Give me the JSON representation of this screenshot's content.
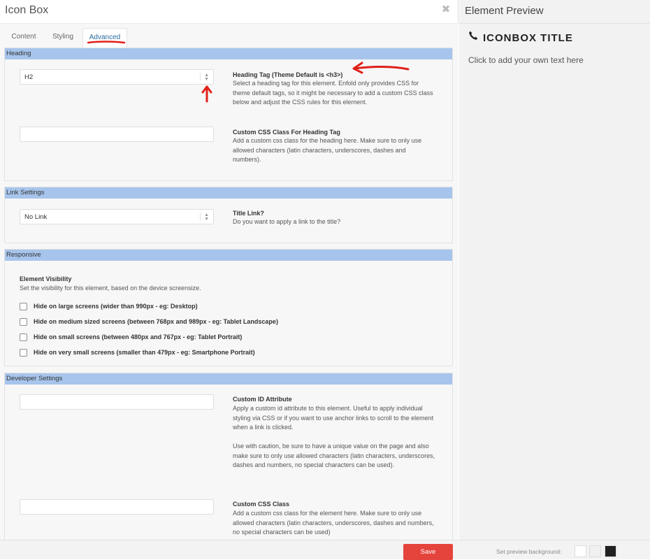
{
  "modal": {
    "title": "Icon Box",
    "tabs": [
      "Content",
      "Styling",
      "Advanced"
    ],
    "active_tab": "Advanced"
  },
  "sections": {
    "heading": {
      "header": "Heading",
      "tag_select": {
        "value": "H2"
      },
      "tag_title": "Heading Tag (Theme Default is <h3>)",
      "tag_desc": "Select a heading tag for this element. Enfold only provides CSS for theme default tags, so it might be necessary to add a custom CSS class below and adjust the CSS rules for this element.",
      "css_value": "",
      "css_title": "Custom CSS Class For Heading Tag",
      "css_desc": "Add a custom css class for the heading here. Make sure to only use allowed characters (latin characters, underscores, dashes and numbers)."
    },
    "link": {
      "header": "Link Settings",
      "select": {
        "value": "No Link"
      },
      "title": "Title Link?",
      "desc": "Do you want to apply a link to the title?"
    },
    "responsive": {
      "header": "Responsive",
      "title": "Element Visibility",
      "desc": "Set the visibility for this element, based on the device screensize.",
      "checkboxes": [
        {
          "label": "Hide on large screens (wider than 990px - eg: Desktop)",
          "checked": false
        },
        {
          "label": "Hide on medium sized screens (between 768px and 989px - eg: Tablet Landscape)",
          "checked": false
        },
        {
          "label": "Hide on small screens (between 480px and 767px - eg: Tablet Portrait)",
          "checked": false
        },
        {
          "label": "Hide on very small screens (smaller than 479px - eg: Smartphone Portrait)",
          "checked": false
        }
      ]
    },
    "developer": {
      "header": "Developer Settings",
      "id_value": "",
      "id_title": "Custom ID Attribute",
      "id_desc1": "Apply a custom id attribute to this element. Useful to apply individual styling via CSS or if you want to use anchor links to scroll to the element when a link is clicked.",
      "id_desc2": "Use with caution, be sure to have a unique value on the page and also make sure to only use allowed characters (latin characters, underscores, dashes and numbers, no special characters can be used).",
      "class_value": "",
      "class_title": "Custom CSS Class",
      "class_desc": "Add a custom css class for the element here. Make sure to only use allowed characters (latin characters, underscores, dashes and numbers, no special characters can be used)"
    }
  },
  "footer": {
    "save_label": "Save",
    "bg_label": "Set preview background:",
    "swatches": [
      "#ffffff",
      "#f0f0f0",
      "#222222"
    ]
  },
  "preview": {
    "title": "Element Preview",
    "iconbox_title": "ICONBOX TITLE",
    "iconbox_text": "Click to add your own text here",
    "icon": "phone-icon"
  },
  "colors": {
    "section_header": "#a7c5ec",
    "save_button": "#e5443d",
    "annotation": "#e0201a",
    "active_tab_text": "#2a6a9c"
  }
}
